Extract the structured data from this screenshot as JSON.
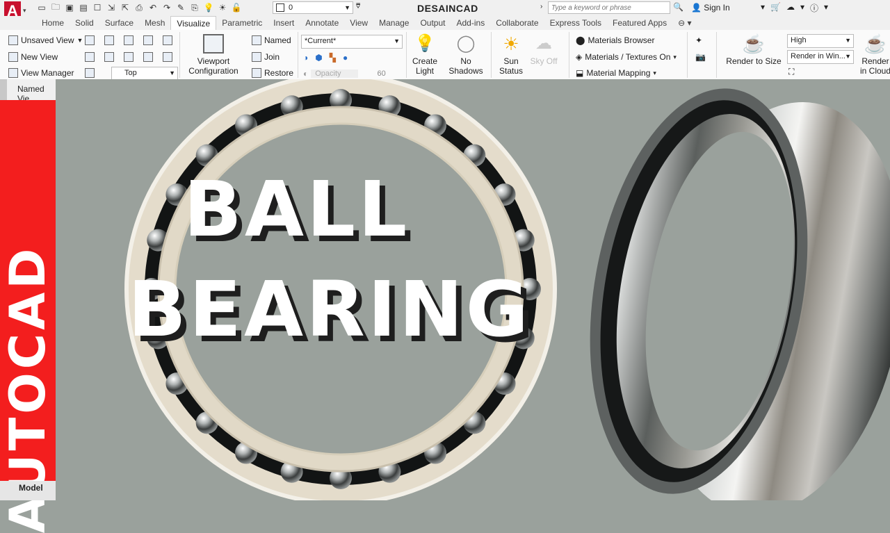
{
  "app": {
    "title": "DESAINCAD",
    "logo_letter": "A"
  },
  "qat": {
    "layer_value": "0",
    "search_placeholder": "Type a keyword or phrase",
    "sign_in": "Sign In"
  },
  "tabs": [
    "Home",
    "Solid",
    "Surface",
    "Mesh",
    "Visualize",
    "Parametric",
    "Insert",
    "Annotate",
    "View",
    "Manage",
    "Output",
    "Add-ins",
    "Collaborate",
    "Express Tools",
    "Featured Apps"
  ],
  "active_tab": "Visualize",
  "ribbon": {
    "views": {
      "unsaved_view": "Unsaved View",
      "new_view": "New View",
      "view_manager": "View Manager",
      "panel_label": "Named Views"
    },
    "top_view": "Top",
    "viewport": {
      "config": "Viewport Configuration",
      "named": "Named",
      "join": "Join",
      "restore": "Restore"
    },
    "visual_style": {
      "current": "*Current*",
      "opacity_label": "Opacity",
      "opacity_value": "60"
    },
    "lights": {
      "create_light": "Create Light",
      "no_shadows": "No Shadows",
      "sun_status": "Sun Status",
      "sky_off": "Sky Off"
    },
    "materials": {
      "browser": "Materials Browser",
      "textures": "Materials / Textures On",
      "mapping": "Material Mapping"
    },
    "render": {
      "render_to_size": "Render to Size",
      "quality": "High",
      "render_in": "Render in Win...",
      "render_cloud": "Render in Cloud"
    }
  },
  "left_panel": {
    "named_view_short": "Named Vie",
    "side_title": "AUTOCAD",
    "model_tab": "Model"
  },
  "thumbnail": {
    "headline_line1": "BALL",
    "headline_line2": "BEARING"
  },
  "colors": {
    "accent_red": "#f31e1e",
    "viewport_bg": "#9aa19c",
    "ring_cream": "#e4dccb",
    "steel": "#c9cccc"
  }
}
